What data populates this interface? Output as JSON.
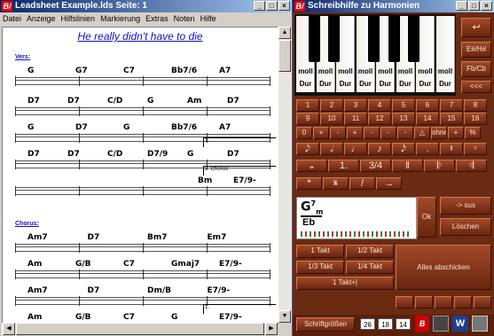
{
  "left_window": {
    "title": "Leadsheet Example.lds  Seite: 1",
    "app_icon": "B/",
    "menu": [
      "Datei",
      "Anzeige",
      "Hilfslinien",
      "Markierung",
      "Extras",
      "Noten",
      "Hilfe"
    ],
    "song_title": "He really didn't have to die",
    "sections": {
      "verse": "Vers:",
      "chorus": "Chorus:"
    },
    "verse_rows": [
      [
        "G",
        "G7",
        "C7",
        "Bb7/6",
        "A7"
      ],
      [
        "D7",
        "D7",
        "C/D",
        "G",
        "Am",
        "D7"
      ],
      [
        "G",
        "D7",
        "G",
        "Bb7/6",
        "A7"
      ],
      [
        "D7",
        "D7",
        "C/D",
        "D7/9",
        "G",
        "D7"
      ],
      [
        "Bm",
        "E7/9-"
      ]
    ],
    "chorus_rows": [
      [
        "Am7",
        "D7",
        "Bm7",
        "Em7"
      ],
      [
        "Am",
        "G/B",
        "C7",
        "Gmaj7",
        "E7/9-"
      ],
      [
        "Am7",
        "D7",
        "Dm/B",
        "E7/9-"
      ],
      [
        "Am",
        "G/B",
        "C7",
        "G",
        "E7/9-"
      ]
    ],
    "endings": {
      "first": "1.",
      "second": "2. Chorus:"
    }
  },
  "right_window": {
    "title": "Schreibhilfe zu Harmonien",
    "app_icon": "B/",
    "key_labels_moll": "moll",
    "key_labels_dur": "Dur",
    "side_buttons": [
      "↩",
      "E#/H#",
      "Fb/Cb",
      "<<<"
    ],
    "number_rows": [
      [
        "1",
        "2",
        "3",
        "4",
        "5",
        "6",
        "7",
        "8"
      ],
      [
        "9",
        "10",
        "11",
        "12",
        "13",
        "14",
        "15",
        "16"
      ]
    ],
    "mod_row": [
      "0",
      "+",
      "-",
      "+",
      "-",
      "-",
      "-",
      "△",
      "ohne",
      "+",
      "%"
    ],
    "note_row": [
      "𝅘𝅥𝅮",
      "𝅗𝅥",
      "♩",
      "♪",
      "𝅘𝅥𝅯",
      ".",
      "𝄽",
      "𝄾"
    ],
    "bar_row": [
      "𝅝",
      "1.",
      "3/4",
      "‖",
      "𝄆",
      "𝄇"
    ],
    "sym_row": [
      "𝄌",
      "𝄋",
      "/",
      "→"
    ],
    "preview_chord": {
      "root": "G",
      "sup": "7",
      "sub": "m",
      "bass": "Eb"
    },
    "ok_label": "Ok",
    "sus_label": "-> sus",
    "delete_label": "Löschen",
    "takt_buttons": [
      "1 Takt",
      "1/2 Takt",
      "1/3 Takt",
      "1/4 Takt",
      "1 Takt+|"
    ],
    "cancel_all_label": "Alles abschicken",
    "font_size_label": "Schriftgrößen",
    "font_sizes": [
      "26",
      "18",
      "14"
    ]
  }
}
